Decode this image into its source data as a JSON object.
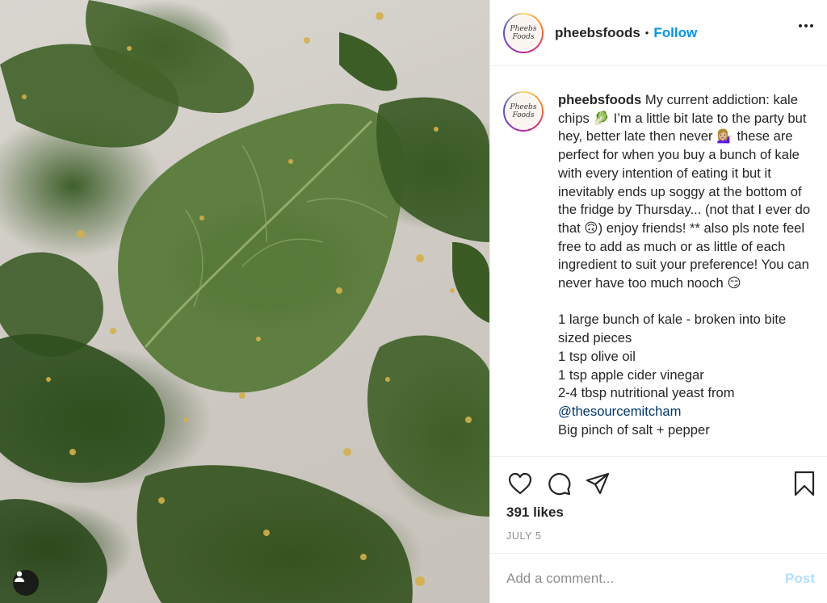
{
  "post": {
    "username": "pheebsfoods",
    "follow_separator": "•",
    "follow_label": "Follow",
    "avatar_text": [
      "Pheebs",
      "Foods"
    ],
    "caption_text": " My current addiction: kale chips 🥬 I’m a little bit late to the party but hey, better late then never 💁🏼‍♀️ these are perfect for when you buy a bunch of kale with every intention of eating it but it inevitably ends up soggy at the bottom of the fridge by Thursday... (not that I ever do that 🙃) enjoy friends! ** also pls note feel free to add as much or as little of each ingredient to suit your preference! You can never have too much nooch 😏\n\n1 large bunch of kale - broken into bite sized pieces\n1 tsp olive oil\n1 tsp apple cider vinegar\n2-4 tbsp nutritional yeast from ",
    "caption_mention": "@thesourcemitcham",
    "caption_after": "\nBig pinch of salt + pepper",
    "likes_text": "391 likes",
    "date_text": "JULY 5",
    "comment_placeholder": "Add a comment...",
    "post_label": "Post"
  },
  "icons": {
    "like": "heart-icon",
    "comment": "comment-icon",
    "share": "paper-plane-icon",
    "save": "bookmark-icon",
    "more": "more-options-icon",
    "tagged_users": "user-icon"
  },
  "colors": {
    "follow": "#0095f6",
    "post_disabled": "#b2dffc",
    "muted": "#8e8e8e",
    "text": "#262626"
  }
}
